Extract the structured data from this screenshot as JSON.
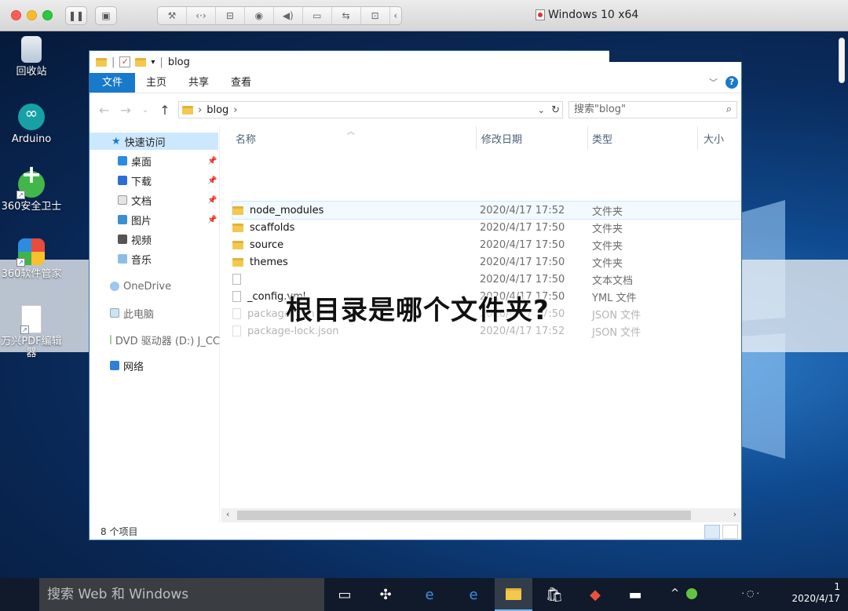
{
  "vm": {
    "title": "Windows 10 x64"
  },
  "desktop": {
    "icons": [
      {
        "label": "回收站",
        "icon": "recycle-bin-icon"
      },
      {
        "label": "Arduino",
        "icon": "arduino-icon"
      },
      {
        "label": "360安全卫士",
        "icon": "360-safe-icon"
      },
      {
        "label": "360软件管家",
        "icon": "360-software-manager-icon"
      },
      {
        "label": "万兴PDF编辑器",
        "icon": "pdf-editor-icon"
      }
    ]
  },
  "explorer": {
    "title": "blog",
    "ribbon": {
      "tabs": [
        "文件",
        "主页",
        "共享",
        "查看"
      ]
    },
    "address": {
      "path": "blog",
      "search_placeholder": "搜索\"blog\""
    },
    "nav": {
      "quick_access": "快速访问",
      "items": [
        "桌面",
        "下载",
        "文档",
        "图片",
        "视频",
        "音乐"
      ],
      "onedrive": "OneDrive",
      "this_pc": "此电脑",
      "dvd": "DVD 驱动器 (D:) J_CC",
      "network": "网络"
    },
    "columns": {
      "name": "名称",
      "date": "修改日期",
      "type": "类型",
      "size": "大小"
    },
    "files": [
      {
        "name": "node_modules",
        "date": "2020/4/17 17:52",
        "type": "文件夹",
        "kind": "folder"
      },
      {
        "name": "scaffolds",
        "date": "2020/4/17 17:50",
        "type": "文件夹",
        "kind": "folder"
      },
      {
        "name": "source",
        "date": "2020/4/17 17:50",
        "type": "文件夹",
        "kind": "folder"
      },
      {
        "name": "themes",
        "date": "2020/4/17 17:50",
        "type": "文件夹",
        "kind": "folder"
      },
      {
        "name": "",
        "date": "2020/4/17 17:50",
        "type": "文本文档",
        "kind": "file"
      },
      {
        "name": "_config.yml",
        "date": "2020/4/17 17:50",
        "type": "YML 文件",
        "kind": "file"
      },
      {
        "name": "package.json",
        "date": "2020/4/17 17:50",
        "type": "JSON 文件",
        "kind": "file-faded"
      },
      {
        "name": "package-lock.json",
        "date": "2020/4/17 17:52",
        "type": "JSON 文件",
        "kind": "file-faded"
      }
    ],
    "status": "8 个项目"
  },
  "overlay": {
    "question": "根目录是哪个文件夹?"
  },
  "taskbar": {
    "search_placeholder": "搜索 Web 和 Windows",
    "clock_time": "1",
    "clock_date": "2020/4/17"
  },
  "colors": {
    "accent": "#1979ca",
    "selection": "#cce8ff",
    "taskbar": "#101a2a"
  }
}
